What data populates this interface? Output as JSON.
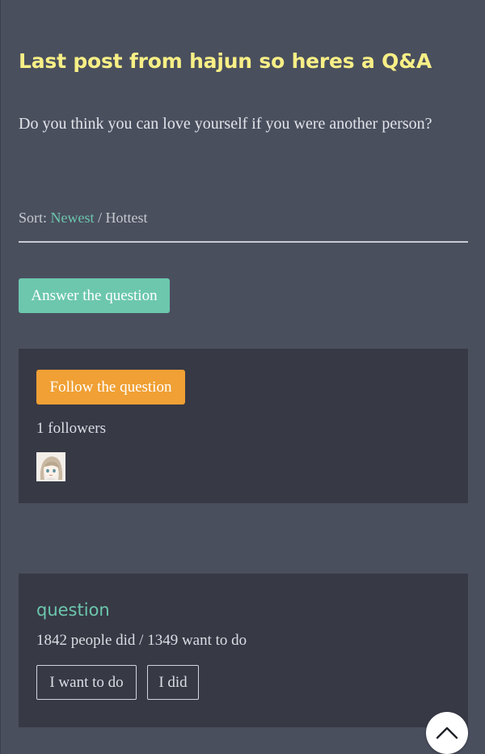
{
  "post": {
    "title": "Last post from hajun so heres a Q&A",
    "question": "Do you think you can love yourself if you were another person?"
  },
  "sort": {
    "label": "Sort:",
    "newest": "Newest",
    "separator": "/",
    "hottest": "Hottest",
    "active": "Newest"
  },
  "actions": {
    "answer_label": "Answer the question"
  },
  "follow_card": {
    "follow_label": "Follow the question",
    "followers_text": "1 followers"
  },
  "stats_card": {
    "title": "question",
    "counts_text": "1842 people did / 1349 want to do",
    "want_label": "I want to do",
    "did_label": "I did"
  },
  "colors": {
    "background": "#4a4f5e",
    "card": "#373945",
    "accent_green": "#6cc7ad",
    "accent_orange": "#f0a034",
    "title_yellow": "#f7ef86"
  },
  "icons": {
    "scroll_top": "chevron-up-icon",
    "avatar": "anime-avatar"
  }
}
